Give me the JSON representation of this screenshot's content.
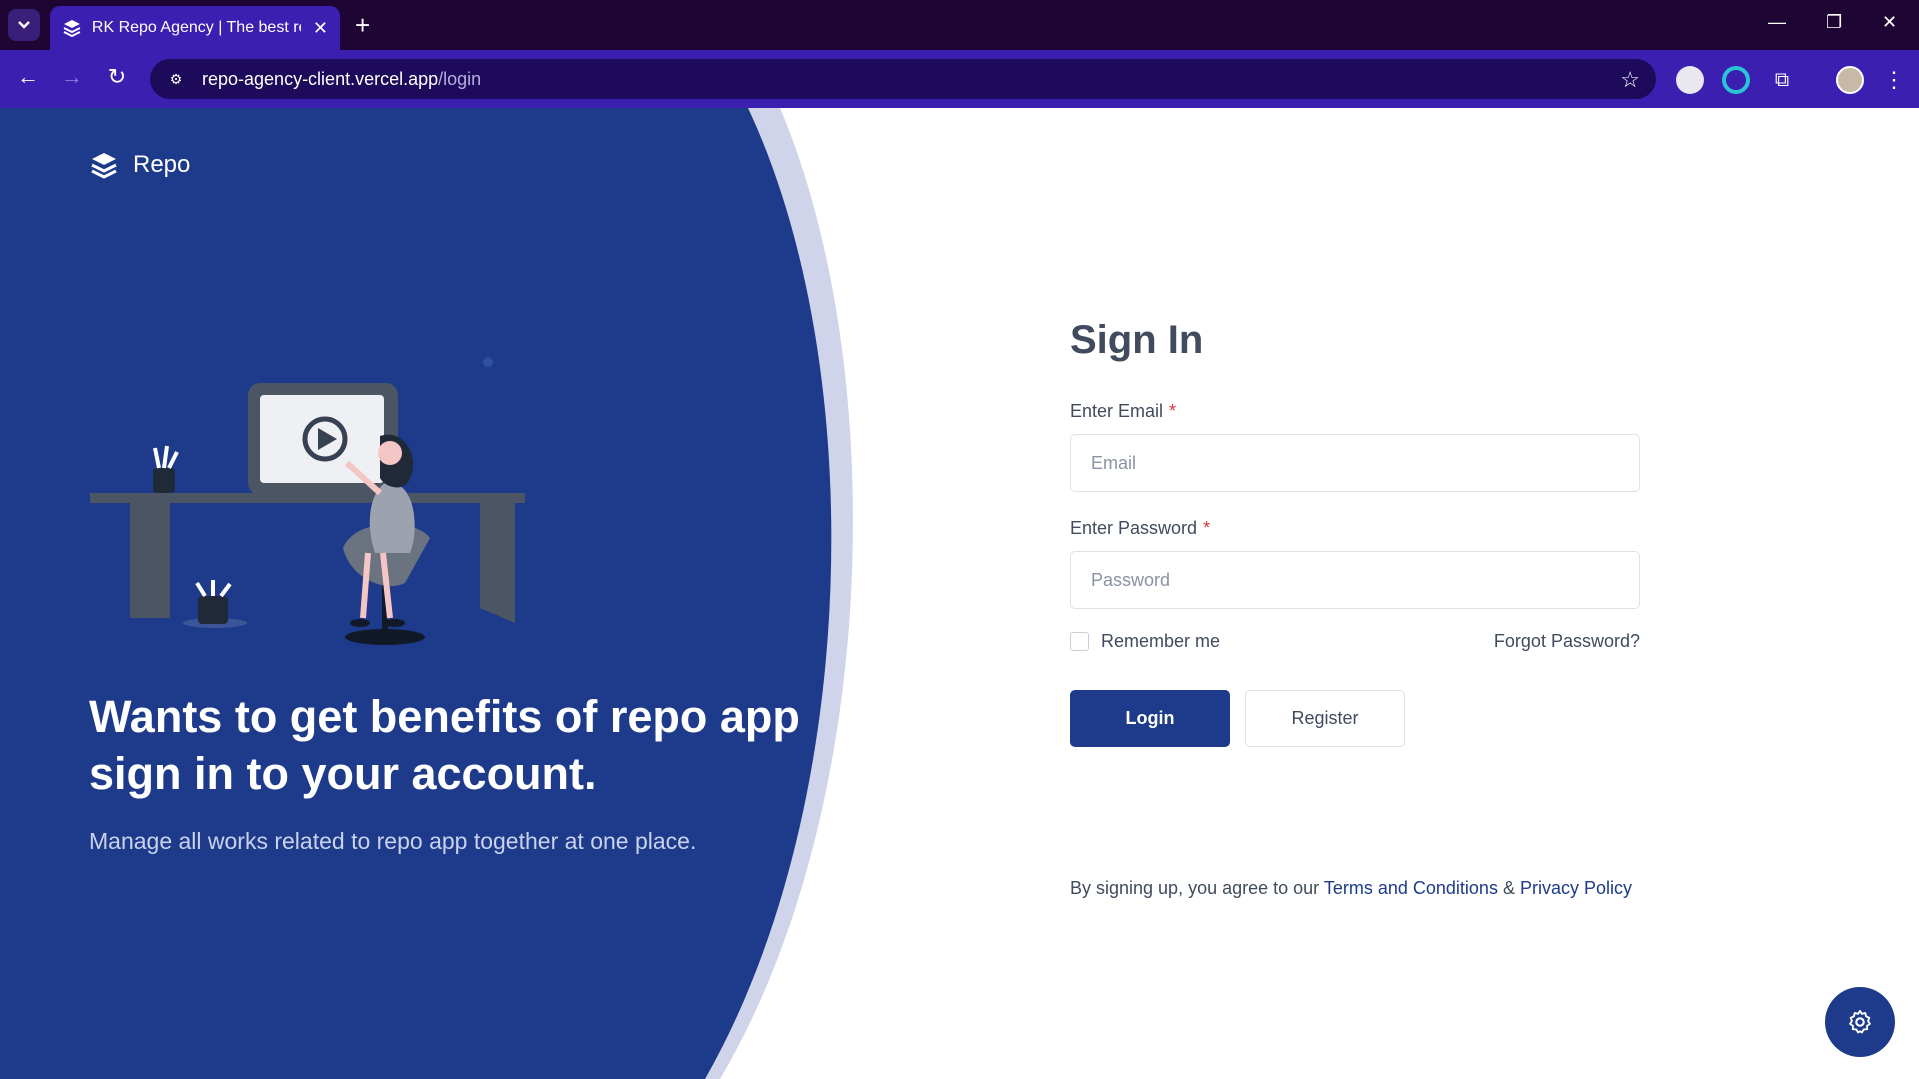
{
  "browser": {
    "tab_title": "RK Repo Agency | The best recc",
    "url_host": "repo-agency-client.vercel.app",
    "url_path": "/login"
  },
  "brand": {
    "name": "Repo"
  },
  "hero": {
    "headline": "Wants to get benefits of repo app sign in to your account.",
    "subline": "Manage all works related to repo app together at one place."
  },
  "form": {
    "title": "Sign In",
    "email_label": "Enter Email",
    "email_placeholder": "Email",
    "password_label": "Enter Password",
    "password_placeholder": "Password",
    "required_mark": "*",
    "remember_label": "Remember me",
    "forgot_label": "Forgot Password?",
    "login_label": "Login",
    "register_label": "Register"
  },
  "legal": {
    "prefix": "By signing up, you agree to our",
    "terms": "Terms and Conditions",
    "amp": "&",
    "privacy": "Privacy Policy"
  },
  "colors": {
    "primary": "#1e3a8a",
    "browser_bar": "#3b1fb0",
    "tabstrip": "#1e0533"
  }
}
